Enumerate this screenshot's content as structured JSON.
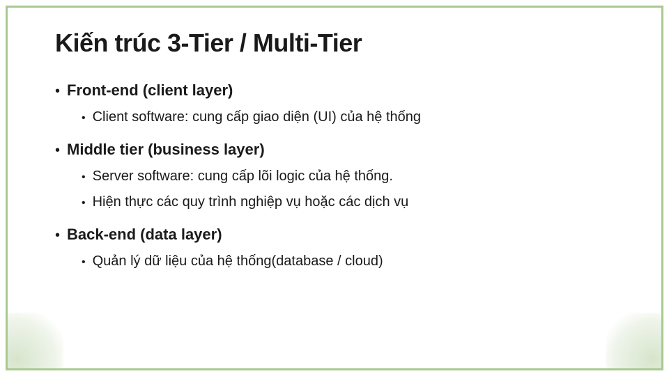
{
  "title": "Kiến trúc 3-Tier / Multi-Tier",
  "sections": [
    {
      "heading": "Front-end (client layer)",
      "items": [
        "Client software: cung cấp giao diện (UI) của hệ thống"
      ]
    },
    {
      "heading": "Middle tier (business layer)",
      "items": [
        "Server software: cung cấp lõi logic của hệ thống.",
        "Hiện thực các quy trình nghiệp vụ hoặc các dịch vụ"
      ]
    },
    {
      "heading": "Back-end (data layer)",
      "items": [
        "Quản lý dữ liệu của hệ thống(database / cloud)"
      ]
    }
  ]
}
